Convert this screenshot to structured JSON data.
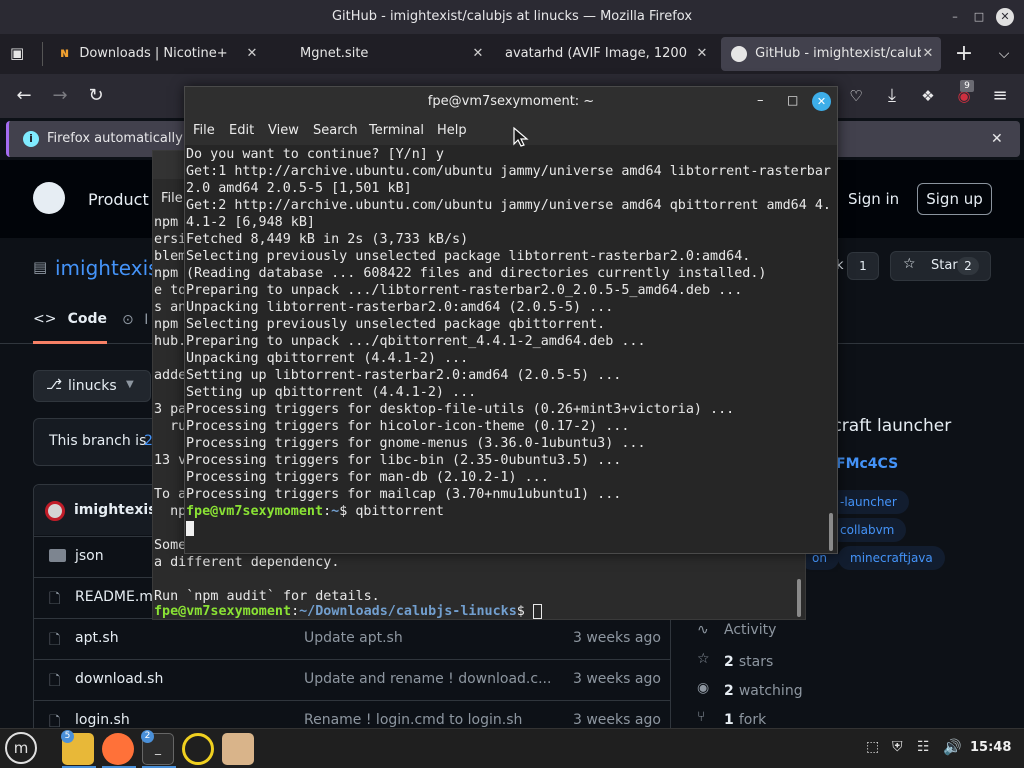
{
  "window": {
    "title": "GitHub - imightexist/calubjs at linucks — Mozilla Firefox"
  },
  "tabs": [
    {
      "label": "Downloads | Nicotine+"
    },
    {
      "label": "Mgnet.site"
    },
    {
      "label": "avatarhd (AVIF Image, 1200 × 1"
    },
    {
      "label": "GitHub - imightexist/calubjs"
    }
  ],
  "extension_badge": "9",
  "notification": {
    "text": "Firefox automatically s"
  },
  "github": {
    "product_label": "Product",
    "sign_in": "Sign in",
    "sign_up": "Sign up",
    "repo_owner": "imightexis",
    "fork_count": "1",
    "star_label": "Star",
    "star_count": "2",
    "tab_code": "Code",
    "tab_issues_partial": "I",
    "branch": "linucks",
    "branch_notice": "This branch is",
    "branch_notice_num": "2",
    "commit_author": "imightexist",
    "about_desc": "ecraft launcher",
    "about_link": "FMc4CS",
    "topics": [
      "-launcher",
      "collabvm",
      "on",
      "minecraftjava"
    ],
    "files": [
      {
        "name": "json",
        "msg": "",
        "time": "",
        "type": "folder"
      },
      {
        "name": "README.m",
        "msg": "",
        "time": "",
        "type": "file"
      },
      {
        "name": "apt.sh",
        "msg": "Update apt.sh",
        "time": "3 weeks ago",
        "type": "file"
      },
      {
        "name": "download.sh",
        "msg": "Update and rename ! download.c...",
        "time": "3 weeks ago",
        "type": "file"
      },
      {
        "name": "login.sh",
        "msg": "Rename ! login.cmd to login.sh",
        "time": "3 weeks ago",
        "type": "file"
      }
    ],
    "sidebar": {
      "activity": "Activity",
      "stars_num": "2",
      "stars_label": "stars",
      "watching_num": "2",
      "watching_label": "watching",
      "forks_num": "1",
      "forks_label": "fork"
    }
  },
  "terminal_back": {
    "menu_partial": "File",
    "lines": [
      "npm",
      "ersi",
      "blem",
      "npm",
      "e to",
      "s an",
      "npm",
      "hub.",
      "",
      "adde",
      "",
      "3 pa",
      "  ru",
      "",
      "13 v",
      "",
      "To a",
      "  np",
      "",
      "Some",
      "a different dependency.",
      "",
      "Run `npm audit` for details."
    ],
    "prompt_user": "fpe@vm7sexymoment",
    "prompt_path": "~/Downloads/calubjs-linucks",
    "prompt_symbol": "$"
  },
  "terminal_front": {
    "title": "fpe@vm7sexymoment: ~",
    "menu": [
      "File",
      "Edit",
      "View",
      "Search",
      "Terminal",
      "Help"
    ],
    "lines": [
      "Do you want to continue? [Y/n] y",
      "Get:1 http://archive.ubuntu.com/ubuntu jammy/universe amd64 libtorrent-rasterbar",
      "2.0 amd64 2.0.5-5 [1,501 kB]",
      "Get:2 http://archive.ubuntu.com/ubuntu jammy/universe amd64 qbittorrent amd64 4.",
      "4.1-2 [6,948 kB]",
      "Fetched 8,449 kB in 2s (3,733 kB/s)",
      "Selecting previously unselected package libtorrent-rasterbar2.0:amd64.",
      "(Reading database ... 608422 files and directories currently installed.)",
      "Preparing to unpack .../libtorrent-rasterbar2.0_2.0.5-5_amd64.deb ...",
      "Unpacking libtorrent-rasterbar2.0:amd64 (2.0.5-5) ...",
      "Selecting previously unselected package qbittorrent.",
      "Preparing to unpack .../qbittorrent_4.4.1-2_amd64.deb ...",
      "Unpacking qbittorrent (4.4.1-2) ...",
      "Setting up libtorrent-rasterbar2.0:amd64 (2.0.5-5) ...",
      "Setting up qbittorrent (4.4.1-2) ...",
      "Processing triggers for desktop-file-utils (0.26+mint3+victoria) ...",
      "Processing triggers for hicolor-icon-theme (0.17-2) ...",
      "Processing triggers for gnome-menus (3.36.0-1ubuntu3) ...",
      "Processing triggers for libc-bin (2.35-0ubuntu3.5) ...",
      "Processing triggers for man-db (2.10.2-1) ...",
      "Processing triggers for mailcap (3.70+nmu1ubuntu1) ..."
    ],
    "prompt_user": "fpe@vm7sexymoment",
    "prompt_path": "~",
    "prompt_symbol": "$",
    "command": "qbittorrent"
  },
  "taskbar": {
    "files_badge": "5",
    "terminal_badge": "2",
    "clock": "15:48"
  }
}
